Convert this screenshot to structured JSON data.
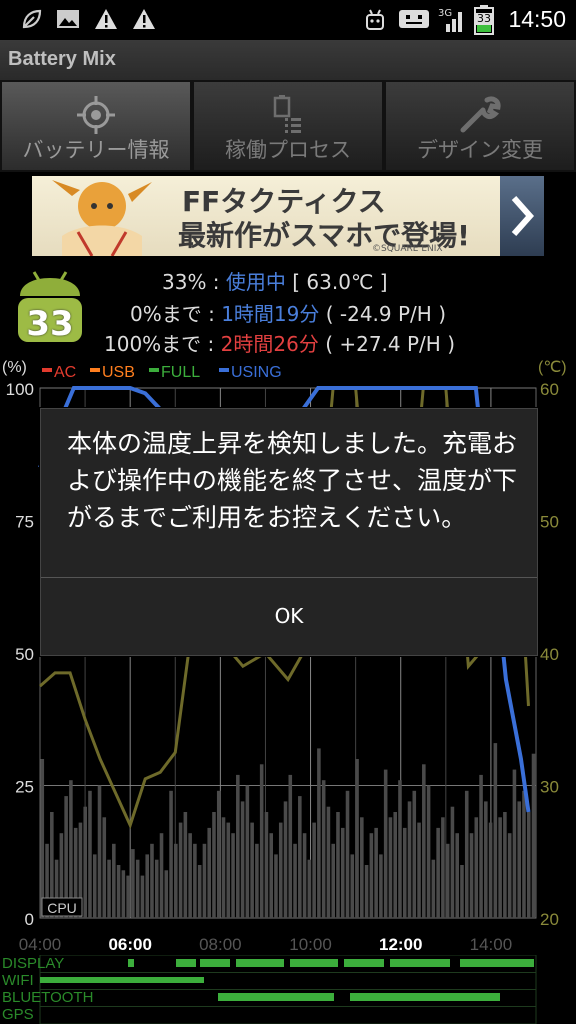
{
  "status_bar": {
    "time": "14:50",
    "battery_level": "33",
    "network": "3G",
    "icons": [
      "leaf-icon",
      "image-icon",
      "warning-icon",
      "warning-icon",
      "android-debug-icon",
      "usb-icon",
      "signal-icon",
      "battery-icon"
    ]
  },
  "app": {
    "title": "Battery Mix"
  },
  "tabs": [
    {
      "label": "バッテリー情報",
      "icon": "target-icon",
      "active": true
    },
    {
      "label": "稼働プロセス",
      "icon": "list-icon",
      "active": false
    },
    {
      "label": "デザイン変更",
      "icon": "wrench-icon",
      "active": false
    }
  ],
  "ad": {
    "line1": "FFタクティクス",
    "line2": "最新作がスマホで登場!",
    "copyright": "©SQUARE ENIX"
  },
  "battery": {
    "badge": "33",
    "percent": "33%",
    "sep1": " : ",
    "state": "使用中",
    "temp": "[ 63.0℃ ]",
    "to_zero_label": "0%まで",
    "to_zero_time": "1時間19分",
    "to_zero_rate": "( -24.9 P/H )",
    "to_full_label": "100%まで",
    "to_full_time": "2時間26分",
    "to_full_rate": "( +27.4 P/H )"
  },
  "chart_data": {
    "type": "line",
    "ylabel_left": "(%)",
    "ylabel_right": "(℃)",
    "y_ticks_left": [
      "100",
      "75",
      "50",
      "25",
      "0"
    ],
    "y_ticks_right": [
      "60",
      "50",
      "40",
      "30",
      "20"
    ],
    "x_ticks": [
      "04:00",
      "06:00",
      "08:00",
      "10:00",
      "12:00",
      "14:00"
    ],
    "legend": [
      "AC",
      "USB",
      "FULL",
      "USING"
    ],
    "legend_colors": [
      "#e23b2e",
      "#ff7f1f",
      "#3cae3c",
      "#3a6fd8"
    ],
    "cpu_label": "CPU",
    "ylim_left": [
      0,
      100
    ],
    "ylim_right": [
      20,
      60
    ],
    "battery_series": {
      "name": "battery",
      "x": [
        "04:00",
        "04:45",
        "05:30",
        "06:00",
        "06:20",
        "06:40",
        "07:00",
        "09:50",
        "10:10",
        "10:20",
        "13:20",
        "13:40",
        "14:20",
        "14:40",
        "14:50"
      ],
      "values": [
        85,
        100,
        100,
        100,
        99,
        96,
        92,
        96,
        100,
        100,
        100,
        100,
        45,
        30,
        20
      ]
    },
    "temp_series": {
      "name": "temperature",
      "x": [
        "04:00",
        "04:20",
        "04:40",
        "05:00",
        "05:20",
        "05:40",
        "06:00",
        "06:20",
        "06:40",
        "07:00",
        "07:20",
        "07:40",
        "08:00",
        "08:30",
        "09:00",
        "09:30",
        "10:00",
        "10:30",
        "11:00",
        "11:30",
        "12:00",
        "12:30",
        "13:00",
        "13:30",
        "14:00",
        "14:30",
        "14:50"
      ],
      "values": [
        37.5,
        38.5,
        38.5,
        35,
        32,
        29.5,
        27,
        30.5,
        31,
        32.5,
        41,
        41,
        41,
        39,
        40,
        38,
        41,
        60,
        60,
        41,
        41,
        60,
        60,
        39,
        41,
        55,
        36
      ]
    },
    "cpu_series": {
      "name": "CPU",
      "values": [
        30,
        14,
        20,
        11,
        16,
        23,
        26,
        17,
        18,
        21,
        24,
        12,
        25,
        19,
        11,
        14,
        10,
        9,
        8,
        13,
        11,
        8,
        12,
        14,
        11,
        16,
        9,
        24,
        14,
        18,
        20,
        16,
        14,
        10,
        14,
        17,
        20,
        24,
        19,
        18,
        16,
        27,
        22,
        25,
        18,
        14,
        29,
        20,
        16,
        12,
        18,
        22,
        27,
        14,
        23,
        16,
        11,
        18,
        32,
        26,
        21,
        14,
        20,
        17,
        24,
        12,
        30,
        19,
        10,
        16,
        17,
        12,
        28,
        19,
        20,
        26,
        17,
        22,
        24,
        18,
        29,
        25,
        11,
        17,
        19,
        14,
        21,
        16,
        10,
        24,
        16,
        19,
        27,
        22,
        18,
        33,
        19,
        20,
        16,
        28,
        22,
        24,
        20,
        31
      ]
    }
  },
  "bottom_status": {
    "labels": [
      "DISPLAY",
      "WIFI",
      "BLUETOOTH",
      "GPS"
    ]
  },
  "dialog": {
    "message": "本体の温度上昇を検知しました。充電および操作中の機能を終了させ、温度が下がるまでご利用をお控えください。",
    "ok_label": "OK"
  }
}
